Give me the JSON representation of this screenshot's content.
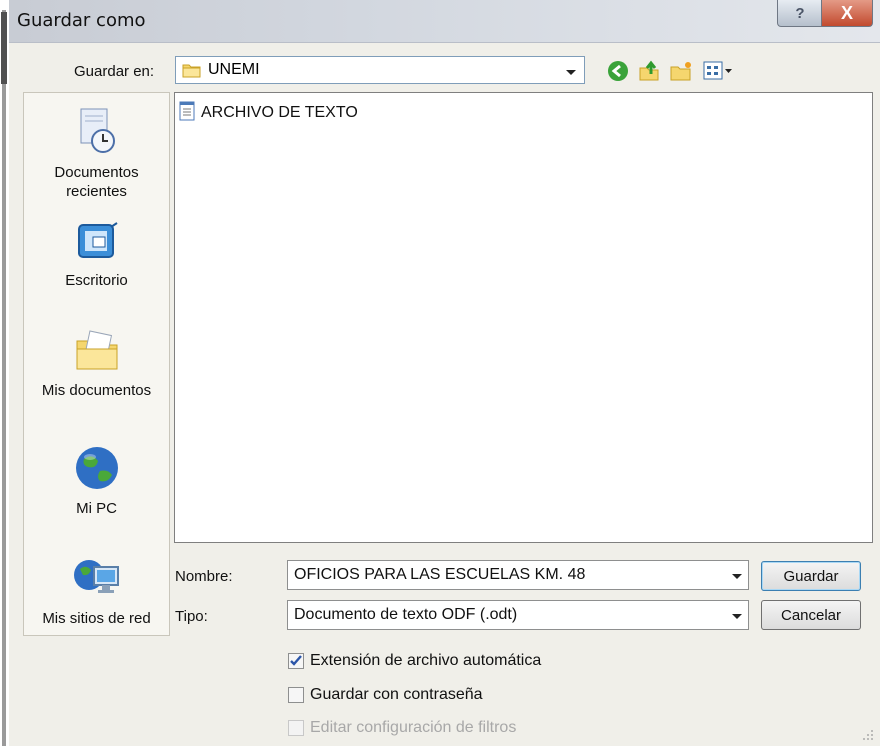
{
  "window": {
    "title": "Guardar como",
    "help": "?",
    "close": "X"
  },
  "toolbar": {
    "save_in_label": "Guardar en:",
    "save_in_value": "UNEMI",
    "icons": [
      "back-icon",
      "up-folder-icon",
      "new-folder-icon",
      "views-menu-icon"
    ]
  },
  "places": [
    {
      "id": "recent",
      "label": "Documentos recientes"
    },
    {
      "id": "desktop",
      "label": "Escritorio"
    },
    {
      "id": "mydocs",
      "label": "Mis documentos"
    },
    {
      "id": "mypc",
      "label": "Mi PC"
    },
    {
      "id": "network",
      "label": "Mis sitios de red"
    }
  ],
  "files": [
    {
      "name": "ARCHIVO DE TEXTO",
      "icon": "text-document-icon"
    }
  ],
  "form": {
    "name_label": "Nombre:",
    "name_value": "OFICIOS PARA LAS ESCUELAS KM. 48",
    "type_label": "Tipo:",
    "type_value": "Documento de texto ODF (.odt)"
  },
  "buttons": {
    "save": "Guardar",
    "cancel": "Cancelar"
  },
  "options": {
    "auto_extension": {
      "label": "Extensión de archivo automática",
      "checked": true
    },
    "password": {
      "label": "Guardar con contraseña",
      "checked": false
    },
    "filter_settings": {
      "label": "Editar configuración de filtros",
      "checked": false,
      "enabled": false
    }
  },
  "colors": {
    "accent": "#3c7fb1",
    "checkmark": "#2b55a8"
  }
}
